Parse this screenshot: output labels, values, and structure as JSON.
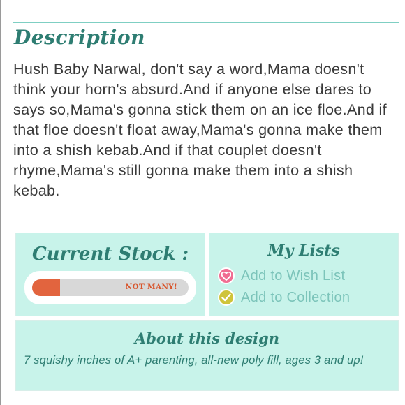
{
  "description": {
    "heading": "Description",
    "body": "Hush Baby Narwal, don't say a word,Mama doesn't think your horn's absurd.And if anyone else dares to says so,Mama's gonna stick them on an ice floe.And if that floe doesn't float away,Mama's gonna make them into a shish kebab.And if that couplet doesn't rhyme,Mama's still gonna make them into a shish kebab."
  },
  "stock": {
    "title": "Current Stock :",
    "level_label": "NOT MANY!",
    "level_fraction": 0.18,
    "fill_color": "#e2643e"
  },
  "lists": {
    "title": "My Lists",
    "wish_list": {
      "label": "Add to Wish List",
      "icon": "heart-icon",
      "color": "#f06d92"
    },
    "collection": {
      "label": "Add to Collection",
      "icon": "check-icon",
      "color": "#cfc43a"
    }
  },
  "about": {
    "title": "About this design",
    "text": "7 squishy inches of A+ parenting, all-new poly fill, ages 3 and up!"
  },
  "colors": {
    "accent": "#2e7d72",
    "panel_background": "#c8f3ea",
    "link": "#7cc4ba"
  }
}
